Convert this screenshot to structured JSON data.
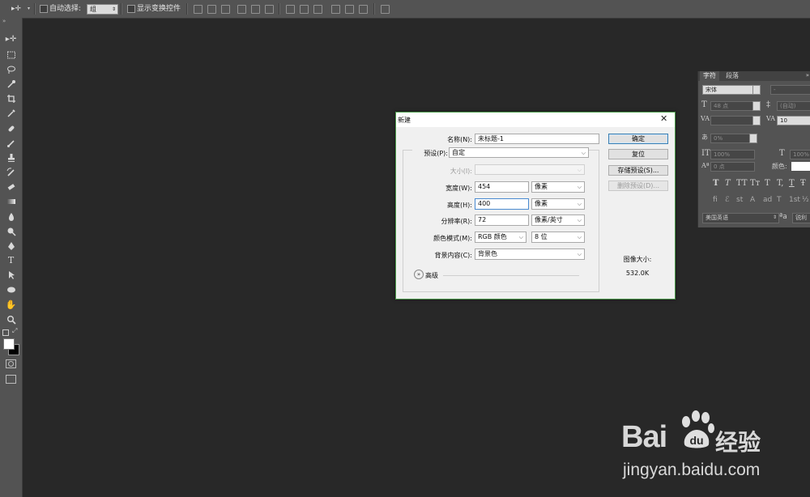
{
  "options_bar": {
    "auto_select_label": "自动选择:",
    "auto_select_target": "组",
    "show_transform_label": "显示变换控件"
  },
  "character_panel": {
    "tabs": [
      "字符",
      "段落"
    ],
    "font_family": "宋体",
    "font_style": "-",
    "font_size": "48 点",
    "leading": "(自动)",
    "tracking": "10",
    "scale_percent": "0%",
    "vertical_scale": "100%",
    "horizontal_scale": "100%",
    "baseline_shift": "0 点",
    "color_label": "颜色:",
    "language": "美国英语",
    "aa_label": "a",
    "aa_value": "锐利",
    "typography_buttons": [
      "T",
      "T",
      "TT",
      "Tт",
      "T",
      "T,",
      "T",
      "Ŧ"
    ]
  },
  "dialog": {
    "title": "新建",
    "name_label": "名称(N):",
    "name_value": "未标题-1",
    "preset_label": "预设(P):",
    "preset_value": "自定",
    "size_label": "大小(I):",
    "width_label": "宽度(W):",
    "width_value": "454",
    "width_unit": "像素",
    "height_label": "高度(H):",
    "height_value": "400",
    "height_unit": "像素",
    "resolution_label": "分辨率(R):",
    "resolution_value": "72",
    "resolution_unit": "像素/英寸",
    "color_mode_label": "颜色模式(M):",
    "color_mode_value": "RGB 颜色",
    "bit_depth_value": "8 位",
    "background_label": "背景内容(C):",
    "background_value": "背景色",
    "advanced_label": "高级",
    "ok_label": "确定",
    "reset_label": "复位",
    "save_preset_label": "存储预设(S)...",
    "delete_preset_label": "删除预设(D)...",
    "image_size_label": "图像大小:",
    "image_size_value": "532.0K"
  },
  "watermark": {
    "brand_left": "Bai",
    "brand_right": "经验",
    "url": "jingyan.baidu.com"
  },
  "colors": {
    "workspace": "#282828",
    "chrome": "#535353",
    "dialog_bg": "#f0f0f0",
    "focus_border": "#4a8ad0"
  }
}
